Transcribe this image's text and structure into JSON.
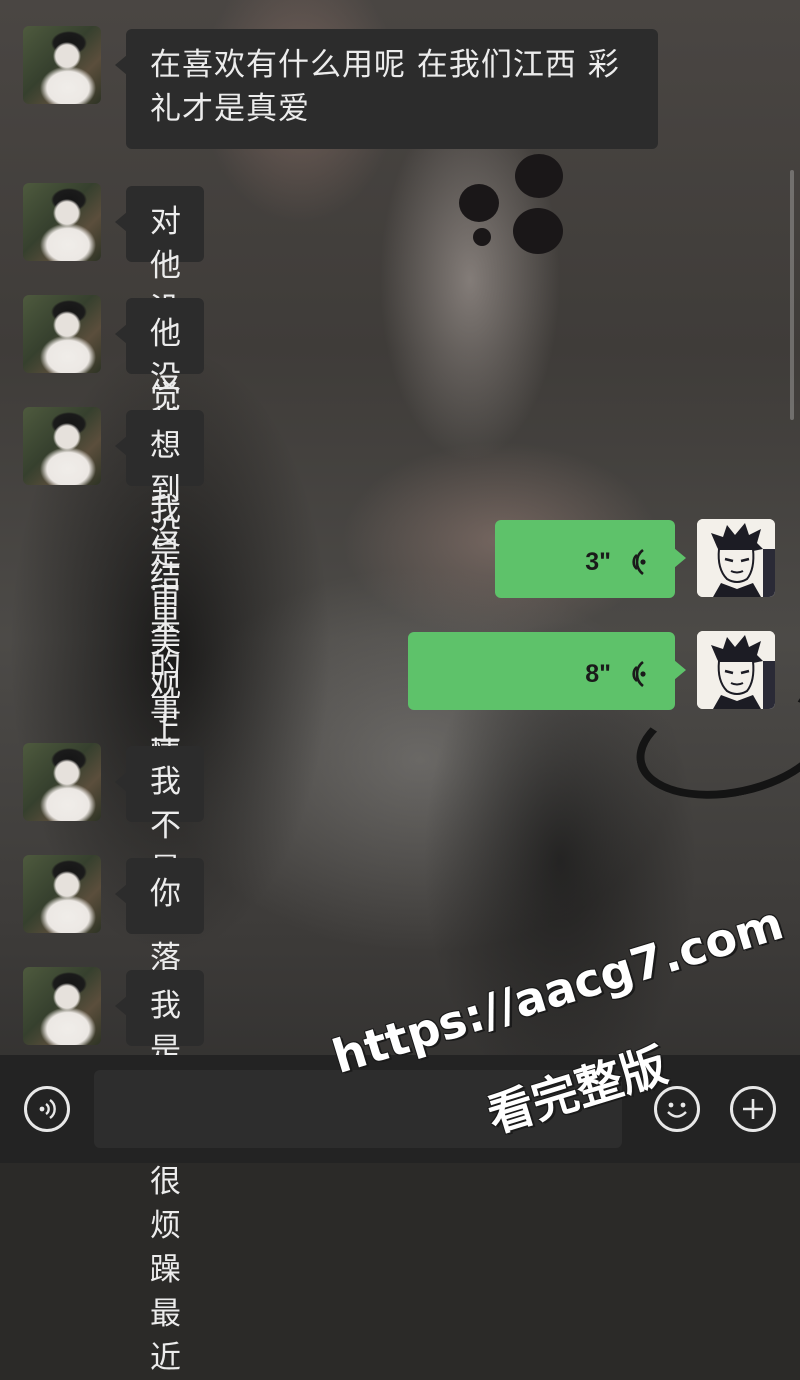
{
  "chat": {
    "messages": [
      {
        "from": "contact",
        "type": "text",
        "text_line1": "在喜欢有什么用呢 在我们江西 彩",
        "text_line2": "礼才是真爱"
      },
      {
        "from": "contact",
        "type": "text",
        "text": "对他没感觉"
      },
      {
        "from": "contact",
        "type": "text",
        "text": "他没长在我是审美观上"
      },
      {
        "from": "contact",
        "type": "text",
        "text": "想到没结果的事情"
      },
      {
        "from": "self",
        "type": "voice",
        "duration": "3\"",
        "icon": "voice-wave-icon"
      },
      {
        "from": "self",
        "type": "voice",
        "duration": "8\"",
        "icon": "voice-wave-icon"
      },
      {
        "from": "contact",
        "type": "text",
        "text": "我不是冷落比"
      },
      {
        "from": "contact",
        "type": "text",
        "text": "你"
      },
      {
        "from": "contact",
        "type": "text",
        "text": "我是真的很烦躁最近"
      }
    ]
  },
  "input_bar": {
    "voice_toggle_icon": "voice-mode-icon",
    "emoji_icon": "emoji-icon",
    "more_icon": "plus-icon",
    "input_value": ""
  },
  "watermark": {
    "line1": "https://aacg7.com",
    "line2": "看完整版"
  },
  "colors": {
    "outgoing_bubble": "#5ec26a",
    "incoming_bubble": "#2c2c2c",
    "input_bar": "#232323"
  }
}
